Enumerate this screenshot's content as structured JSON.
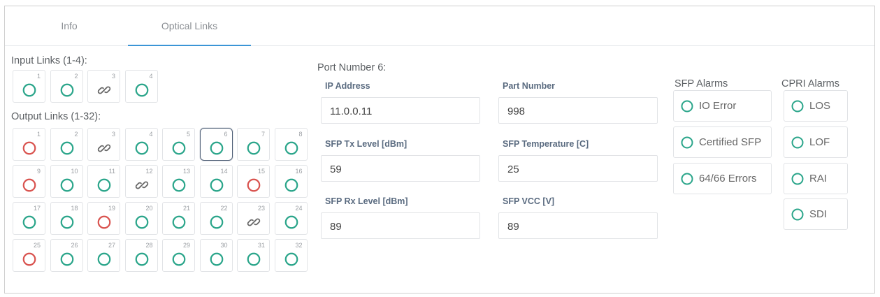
{
  "tabs": [
    {
      "label": "Info",
      "active": false
    },
    {
      "label": "Optical Links",
      "active": true
    }
  ],
  "input_links": {
    "title": "Input Links (1-4):",
    "links": [
      {
        "num": "1",
        "status": "ok"
      },
      {
        "num": "2",
        "status": "ok"
      },
      {
        "num": "3",
        "status": "linked"
      },
      {
        "num": "4",
        "status": "ok"
      }
    ]
  },
  "output_links": {
    "title": "Output Links (1-32):",
    "selected": "6",
    "links": [
      {
        "num": "1",
        "status": "alarm"
      },
      {
        "num": "2",
        "status": "ok"
      },
      {
        "num": "3",
        "status": "linked"
      },
      {
        "num": "4",
        "status": "ok"
      },
      {
        "num": "5",
        "status": "ok"
      },
      {
        "num": "6",
        "status": "ok"
      },
      {
        "num": "7",
        "status": "ok"
      },
      {
        "num": "8",
        "status": "ok"
      },
      {
        "num": "9",
        "status": "alarm"
      },
      {
        "num": "10",
        "status": "ok"
      },
      {
        "num": "11",
        "status": "ok"
      },
      {
        "num": "12",
        "status": "linked"
      },
      {
        "num": "13",
        "status": "ok"
      },
      {
        "num": "14",
        "status": "ok"
      },
      {
        "num": "15",
        "status": "alarm"
      },
      {
        "num": "16",
        "status": "ok"
      },
      {
        "num": "17",
        "status": "ok"
      },
      {
        "num": "18",
        "status": "ok"
      },
      {
        "num": "19",
        "status": "alarm"
      },
      {
        "num": "20",
        "status": "ok"
      },
      {
        "num": "21",
        "status": "ok"
      },
      {
        "num": "22",
        "status": "ok"
      },
      {
        "num": "23",
        "status": "linked"
      },
      {
        "num": "24",
        "status": "ok"
      },
      {
        "num": "25",
        "status": "alarm"
      },
      {
        "num": "26",
        "status": "ok"
      },
      {
        "num": "27",
        "status": "ok"
      },
      {
        "num": "28",
        "status": "ok"
      },
      {
        "num": "29",
        "status": "ok"
      },
      {
        "num": "30",
        "status": "ok"
      },
      {
        "num": "31",
        "status": "ok"
      },
      {
        "num": "32",
        "status": "ok"
      }
    ]
  },
  "port": {
    "title": "Port Number 6:",
    "fields": {
      "ip_address": {
        "label": "IP Address",
        "value": "11.0.0.11"
      },
      "part_number": {
        "label": "Part Number",
        "value": "998"
      },
      "sfp_tx": {
        "label": "SFP Tx Level [dBm]",
        "value": "59"
      },
      "sfp_temp": {
        "label": "SFP Temperature [C]",
        "value": "25"
      },
      "sfp_rx": {
        "label": "SFP Rx Level [dBm]",
        "value": "89"
      },
      "sfp_vcc": {
        "label": "SFP VCC [V]",
        "value": "89"
      }
    }
  },
  "sfp_alarms": {
    "title": "SFP Alarms",
    "items": [
      {
        "label": "IO Error",
        "status": "ok"
      },
      {
        "label": "Certified SFP",
        "status": "ok"
      },
      {
        "label": "64/66 Errors",
        "status": "ok"
      }
    ]
  },
  "cpri_alarms": {
    "title": "CPRI Alarms",
    "items": [
      {
        "label": "LOS",
        "status": "ok"
      },
      {
        "label": "LOF",
        "status": "ok"
      },
      {
        "label": "RAI",
        "status": "ok"
      },
      {
        "label": "SDI",
        "status": "ok"
      }
    ]
  },
  "colors": {
    "ok": "#2aa58a",
    "alarm": "#d9534f",
    "linked": "#666666",
    "tab_accent": "#3b95d6"
  },
  "icons": {
    "ok": "circle-green-icon",
    "alarm": "circle-red-icon",
    "linked": "chain-link-icon"
  }
}
